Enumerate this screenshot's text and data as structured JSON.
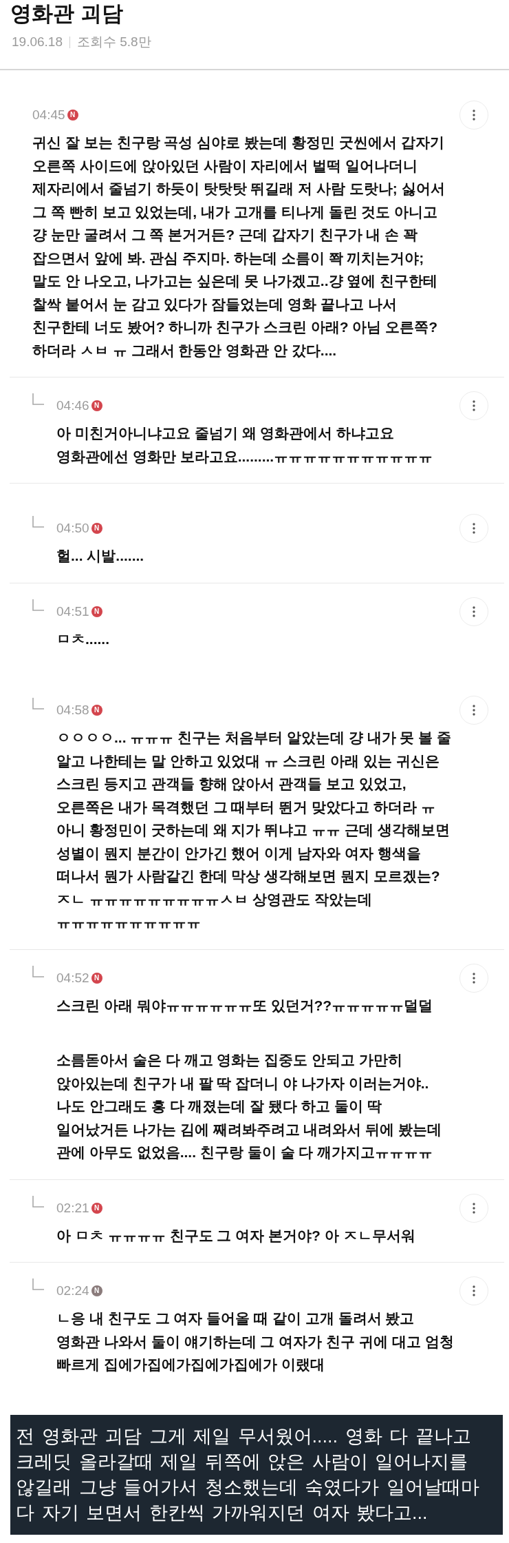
{
  "post": {
    "title": "영화관 괴담",
    "date": "19.06.18",
    "views": "조회수 5.8만"
  },
  "pieces": [
    {
      "comments": [
        {
          "kind": "comment",
          "time": "04:45",
          "badge": {
            "label": "N",
            "color": "#d3454d"
          },
          "rule_below": true,
          "text": "귀신 잘 보는 친구랑 곡성 심야로 봤는데 황정민 굿씬에서 갑자기\n오른쪽 사이드에 앉아있던 사람이 자리에서 벌떡 일어나더니\n제자리에서 줄넘기 하듯이 탓탓탓 뛰길래 저 사람 도랏나; 싫어서\n그 쪽 빤히 보고 있었는데, 내가 고개를 티나게 돌린 것도 아니고\n걍 눈만 굴려서 그 쪽 본거거든? 근데 갑자기 친구가 내 손 꽉\n잡으면서 앞에 봐. 관심 주지마. 하는데 소름이 쫙 끼치는거야;\n말도 안 나오고, 나가고는 싶은데 못 나가겠고..걍 옆에 친구한테\n찰싹 붙어서 눈 감고 있다가 잠들었는데 영화 끝나고 나서\n친구한테 너도 봤어? 하니까 친구가 스크린 아래? 아님 오른쪽?\n하더라 ㅅㅂ ㅠ 그래서 한동안 영화관 안 갔다...."
        },
        {
          "kind": "reply",
          "time": "04:46",
          "badge": {
            "label": "N",
            "color": "#d3454d"
          },
          "rule_below": true,
          "text": "아 미친거아니냐고요 줄넘기 왜 영화관에서 하냐고요\n영화관에선 영화만 보라고요.........ㅠㅠㅠㅠㅠㅠㅠㅠㅠㅠㅠ"
        }
      ]
    },
    {
      "comments": [
        {
          "kind": "reply",
          "time": "04:50",
          "badge": {
            "label": "N",
            "color": "#d3454d"
          },
          "rule_below": true,
          "text": "헐... 시발......."
        },
        {
          "kind": "reply",
          "time": "04:51",
          "badge": {
            "label": "N",
            "color": "#d3454d"
          },
          "rule_below": false,
          "text": "ㅁㅊ......"
        }
      ]
    },
    {
      "comments": [
        {
          "kind": "reply",
          "time": "04:58",
          "badge": {
            "label": "N",
            "color": "#d3454d"
          },
          "rule_below": true,
          "text": "ㅇㅇㅇㅇ... ㅠㅠㅠ 친구는 처음부터 알았는데 걍 내가 못 볼 줄\n알고 나한테는 말 안하고 있었대 ㅠ 스크린 아래 있는 귀신은\n스크린 등지고 관객들 향해 앉아서 관객들 보고 있었고,\n오른쪽은 내가 목격했던 그 때부터 뛴거 맞았다고 하더라 ㅠ\n아니 황정민이 굿하는데 왜 지가 뛰냐고 ㅠㅠ 근데 생각해보면\n성별이 뭔지 분간이 안가긴 했어 이게 남자와 여자 행색을\n떠나서 뭔가 사람같긴 한데 막상 생각해보면 뭔지 모르겠는?\nㅈㄴ ㅠㅠㅠㅠㅠㅠㅠㅠㅠㅅㅂ 상영관도 작았는데\nㅠㅠㅠㅠㅠㅠㅠㅠㅠㅠ"
        },
        {
          "kind": "reply",
          "time": "04:52",
          "badge": {
            "label": "N",
            "color": "#d3454d"
          },
          "rule_below": false,
          "text": "스크린 아래 뭐야ㅠㅠㅠㅠㅠㅠ또 있던거??ㅠㅠㅠㅠㅠ덜덜"
        }
      ]
    },
    {
      "comments": [
        {
          "kind": "continuation",
          "rule_below": true,
          "text": "소름돋아서 술은 다 깨고 영화는 집중도 안되고 가만히\n앉아있는데 친구가 내 팔 딱 잡더니 야 나가자 이러는거야..\n나도 안그래도 흥 다 깨졌는데 잘 됐다 하고 둘이 딱\n일어났거든 나가는 김에 째려봐주려고 내려와서 뒤에 봤는데\n관에 아무도 없었음.... 친구랑 둘이 술 다 깨가지고ㅠㅠㅠㅠ"
        },
        {
          "kind": "reply",
          "time": "02:21",
          "badge": {
            "label": "N",
            "color": "#d3454d"
          },
          "rule_below": true,
          "text": "아 ㅁㅊ ㅠㅠㅠㅠ 친구도 그 여자 본거야? 아 ㅈㄴ무서워"
        },
        {
          "kind": "reply",
          "time": "02:24",
          "badge": {
            "label": "N",
            "color": "#8a7b7b"
          },
          "rule_below": false,
          "text": "ㄴ응 내 친구도 그 여자 들어올 때 같이 고개 돌려서 봤고\n영화관 나와서 둘이 얘기하는데 그 여자가 친구 귀에 대고 엄청\n빠르게 집에가집에가집에가집에가 이랬대"
        }
      ]
    }
  ],
  "caption": "전 영화관 괴담 그게 제일 무서웠어..... 영화 다 끝나고\n크레딧 올라갈때 제일 뒤쪽에 앉은 사람이 일어나지를\n않길래 그냥 들어가서 청소했는데 숙였다가 일어날때마\n다 자기 보면서 한칸씩 가까워지던 여자 봤다고..."
}
